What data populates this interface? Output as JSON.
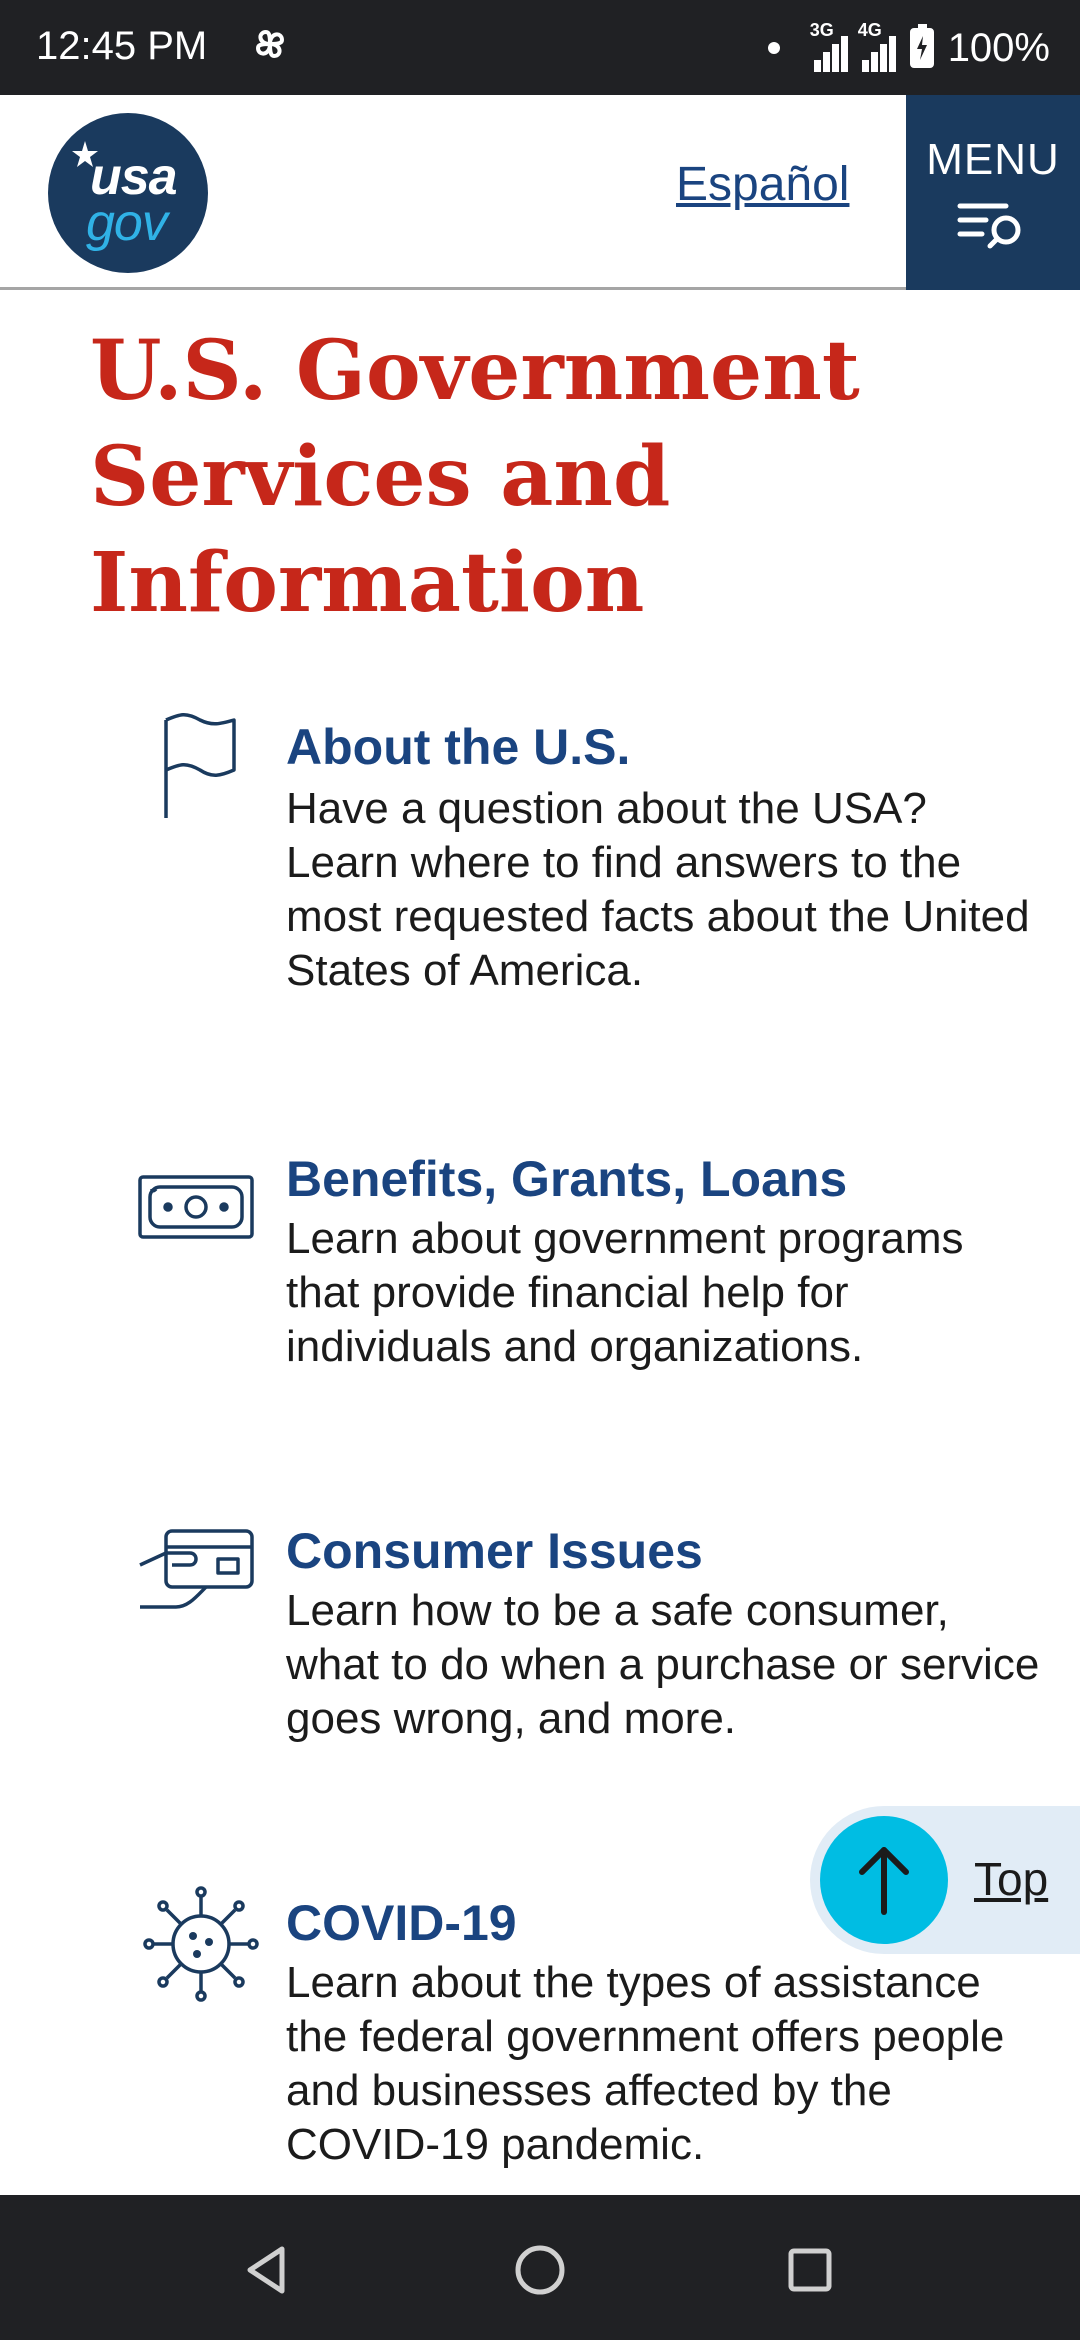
{
  "status_bar": {
    "time": "12:45 PM",
    "network_1": "3G",
    "network_2": "4G",
    "battery": "100%"
  },
  "header": {
    "logo_top": "usa",
    "logo_bottom": "gov",
    "language_link": "Español",
    "menu_label": "MENU"
  },
  "page": {
    "title": "U.S. Government Services and Information"
  },
  "items": [
    {
      "icon": "flag-icon",
      "title": "About the U.S.",
      "description": "Have a question about the USA? Learn where to find answers to the most requested facts about the United States of America."
    },
    {
      "icon": "money-icon",
      "title": "Benefits, Grants, Loans",
      "description": "Learn about government programs that provide financial help for individuals and organizations."
    },
    {
      "icon": "credit-card-hand-icon",
      "title": "Consumer Issues",
      "description": "Learn how to be a safe consumer, what to do when a purchase or service goes wrong, and more."
    },
    {
      "icon": "virus-icon",
      "title": "COVID-19",
      "description": "Learn about the types of assistance the federal government offers people and businesses affected by the COVID-19 pandemic."
    }
  ],
  "back_to_top": {
    "label": "Top"
  },
  "colors": {
    "title_red": "#c6271a",
    "link_blue": "#1a4480",
    "navy": "#1a3a5e",
    "cyan": "#00bde3"
  }
}
